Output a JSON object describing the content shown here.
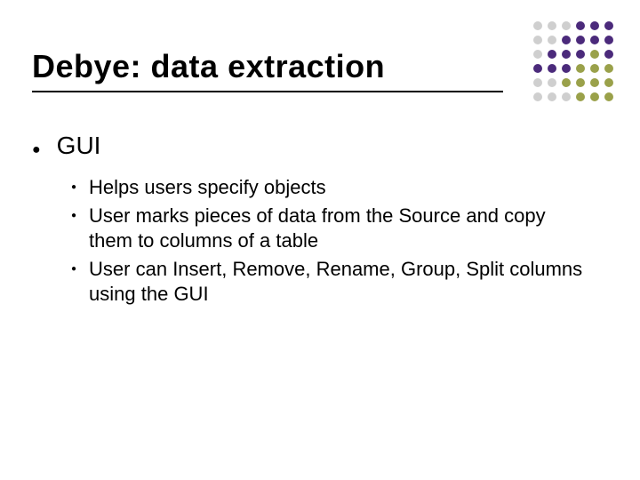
{
  "title": "Debye: data extraction",
  "bullets": {
    "level1": "GUI",
    "level2": [
      "Helps users specify objects",
      "User marks pieces of data from the Source and copy them to columns of a table",
      "User can Insert, Remove, Rename, Group, Split columns using the GUI"
    ]
  },
  "decor": {
    "colors": {
      "purple": "#4b2a7b",
      "olive": "#9aa14a",
      "grey": "#cfcfcf"
    }
  }
}
